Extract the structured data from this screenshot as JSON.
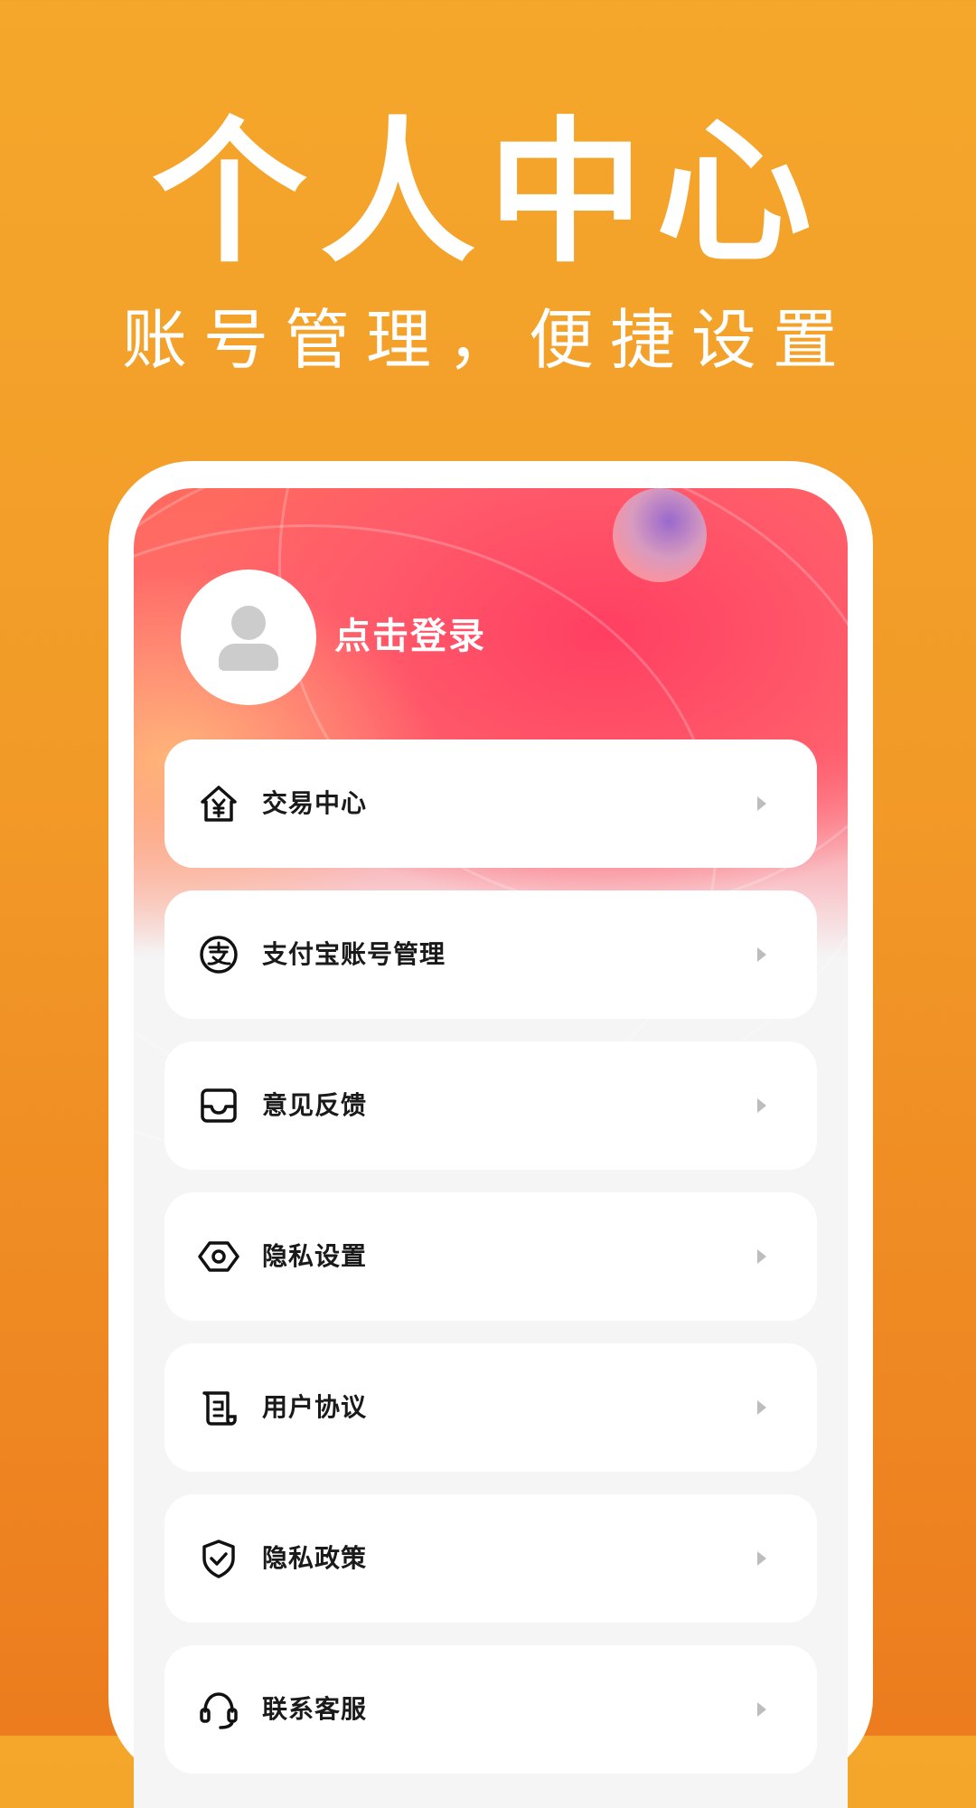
{
  "promo": {
    "title": "个人中心",
    "subtitle": "账号管理，便捷设置"
  },
  "profile": {
    "login_label": "点击登录",
    "avatar_icon": "user-avatar-icon"
  },
  "menu": [
    {
      "label": "交易中心",
      "icon": "house-yen-icon"
    },
    {
      "label": "支付宝账号管理",
      "icon": "alipay-icon"
    },
    {
      "label": "意见反馈",
      "icon": "inbox-icon"
    },
    {
      "label": "隐私设置",
      "icon": "hex-nut-icon"
    },
    {
      "label": "用户协议",
      "icon": "scroll-document-icon"
    },
    {
      "label": "隐私政策",
      "icon": "shield-check-icon"
    },
    {
      "label": "联系客服",
      "icon": "headset-icon"
    }
  ],
  "colors": {
    "background_top": "#f4a72b",
    "background_bottom": "#ec7c1e",
    "header_accent": "#ff3f62",
    "chevron": "#bdbdbd"
  }
}
